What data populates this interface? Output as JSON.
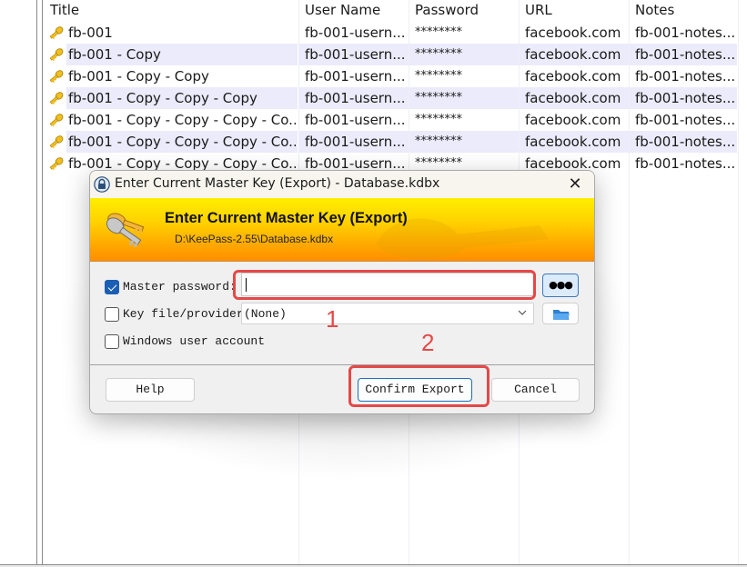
{
  "table": {
    "columns": [
      "Title",
      "User Name",
      "Password",
      "URL",
      "Notes"
    ],
    "rows": [
      {
        "title": "fb-001",
        "username": "fb-001-usern...",
        "password": "********",
        "url": "facebook.com",
        "notes": "fb-001-notes..."
      },
      {
        "title": "fb-001 - Copy",
        "username": "fb-001-usern...",
        "password": "********",
        "url": "facebook.com",
        "notes": "fb-001-notes..."
      },
      {
        "title": "fb-001 - Copy - Copy",
        "username": "fb-001-usern...",
        "password": "********",
        "url": "facebook.com",
        "notes": "fb-001-notes..."
      },
      {
        "title": "fb-001 - Copy - Copy - Copy",
        "username": "fb-001-usern...",
        "password": "********",
        "url": "facebook.com",
        "notes": "fb-001-notes..."
      },
      {
        "title": "fb-001 - Copy - Copy - Copy - Co...",
        "username": "fb-001-usern...",
        "password": "********",
        "url": "facebook.com",
        "notes": "fb-001-notes..."
      },
      {
        "title": "fb-001 - Copy - Copy - Copy - Co...",
        "username": "fb-001-usern...",
        "password": "********",
        "url": "facebook.com",
        "notes": "fb-001-notes..."
      },
      {
        "title": "fb-001 - Copy - Copy - Copy - Co...",
        "username": "fb-001-usern...",
        "password": "********",
        "url": "facebook.com",
        "notes": "fb-001-notes..."
      }
    ],
    "row_icon": "key-icon",
    "alt_row_color": "#ebebfb"
  },
  "dialog": {
    "window_title": "Enter Current Master Key (Export) - Database.kdbx",
    "title_icon": "lock-icon",
    "close_icon": "✕",
    "banner": {
      "title": "Enter Current Master Key (Export)",
      "subtitle": "D:\\KeePass-2.55\\Database.kdbx",
      "icon": "keys-icon"
    },
    "master_password": {
      "label": "Master password:",
      "checked": true,
      "value": "",
      "show_button_label": "●●●"
    },
    "key_file": {
      "label": "Key file/provider:",
      "checked": false,
      "selected": "(None)",
      "browse_icon": "folder-icon"
    },
    "windows_account": {
      "label": "Windows user account",
      "checked": false
    },
    "buttons": {
      "help": "Help",
      "confirm": "Confirm Export",
      "cancel": "Cancel"
    }
  },
  "annotations": {
    "marker_1": "1",
    "marker_2": "2",
    "color": "#e54848"
  }
}
